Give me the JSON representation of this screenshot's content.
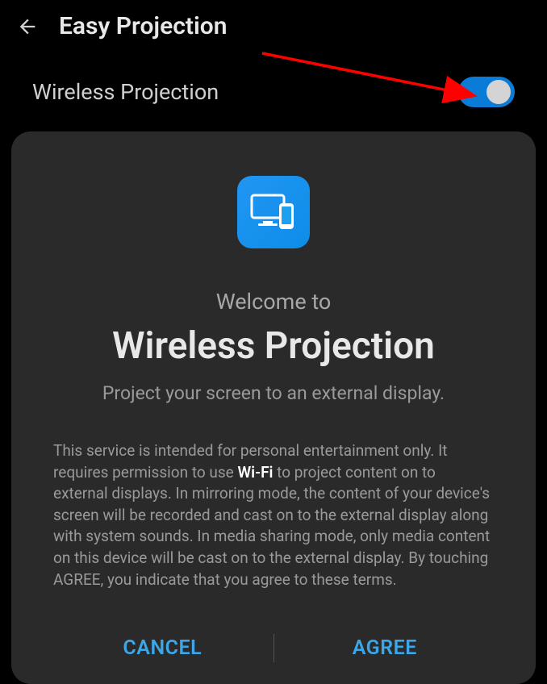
{
  "header": {
    "title": "Easy Projection"
  },
  "setting": {
    "label": "Wireless Projection",
    "enabled": true
  },
  "card": {
    "welcome": "Welcome to",
    "title": "Wireless Projection",
    "subtitle": "Project your screen to an external display.",
    "terms_pre": "This service is intended for personal entertainment only. It requires permission to use ",
    "terms_bold": "Wi-Fi",
    "terms_post": " to project content on to external displays. In mirroring mode, the content of your device's screen will be recorded and cast on to the external display along with system sounds. In media sharing mode, only media content on this device will be cast on to the external display. By touching AGREE, you indicate that you agree to these terms.",
    "cancel_label": "CANCEL",
    "agree_label": "AGREE"
  },
  "colors": {
    "accent": "#0a7cd8",
    "annotation": "#ff0000"
  }
}
